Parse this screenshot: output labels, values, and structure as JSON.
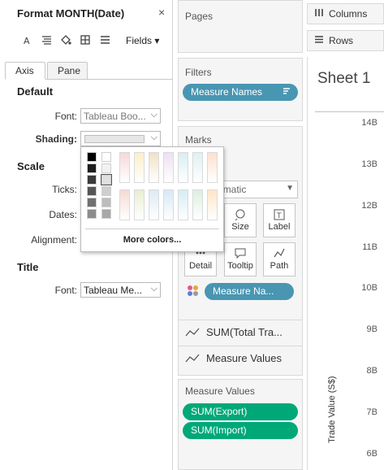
{
  "format_pane": {
    "title": "Format MONTH(Date)",
    "close": "×",
    "toolbar_icons": [
      "font-icon",
      "align-icon",
      "shading-icon",
      "borders-icon",
      "lines-icon"
    ],
    "fields_label": "Fields ▾",
    "tabs": [
      {
        "label": "Axis",
        "active": true
      },
      {
        "label": "Pane",
        "active": false
      }
    ],
    "default_section": "Default",
    "font_label": "Font:",
    "font_value": "Tableau Boo...",
    "shading_label": "Shading:",
    "scale_section": "Scale",
    "ticks_label": "Ticks:",
    "dates_label": "Dates:",
    "alignment_label": "Alignment:",
    "title_section": "Title",
    "title_font_label": "Font:",
    "title_font_value": "Tableau Me..."
  },
  "color_picker": {
    "more_colors": "More colors...",
    "greys": [
      "#000000",
      "#ffffff",
      "#1e1e1e",
      "#f2f2f2",
      "#3a3a3a",
      "#e0e0e0",
      "#555555",
      "#cfcfcf",
      "#707070",
      "#bdbdbd",
      "#8c8c8c",
      "#a8a8a8"
    ],
    "top_pastels": [
      "#f6d9d9",
      "#fbefc8",
      "#f2e0c5",
      "#ede0f3",
      "#d8eef2",
      "#dff0f1",
      "#fbe1ce"
    ],
    "bottom_pastels": [
      "#f5dad4",
      "#e8efd2",
      "#dde9f3",
      "#d7e7f7",
      "#d5edf4",
      "#dcefe0",
      "#fde6c6"
    ],
    "selected": "#e6e6e6"
  },
  "shelves": {
    "pages_title": "Pages",
    "filters_title": "Filters",
    "filter_pill": "Measure Names",
    "marks_title": "Marks",
    "mark_type": "omatic",
    "mark_buttons": [
      {
        "label": "Size",
        "icon": "size-icon"
      },
      {
        "label": "Label",
        "icon": "label-icon"
      },
      {
        "label": "Detail",
        "icon": "detail-icon"
      },
      {
        "label": "Tooltip",
        "icon": "tooltip-icon"
      },
      {
        "label": "Path",
        "icon": "path-icon"
      }
    ],
    "color_pill": "Measure Na...",
    "mark_rows": [
      "SUM(Total Tra...",
      "Measure Values"
    ],
    "measure_values_title": "Measure Values",
    "measure_values_pills": [
      "SUM(Export)",
      "SUM(Import)"
    ]
  },
  "view": {
    "columns_label": "Columns",
    "rows_label": "Rows",
    "sheet_title": "Sheet 1",
    "y_ticks": [
      "14B",
      "13B",
      "12B",
      "11B",
      "10B",
      "9B",
      "8B",
      "7B",
      "6B"
    ],
    "y_axis_label": "Trade Value (S$)"
  },
  "colors": {
    "pill_blue": "#4996b2",
    "pill_green": "#00a878"
  }
}
